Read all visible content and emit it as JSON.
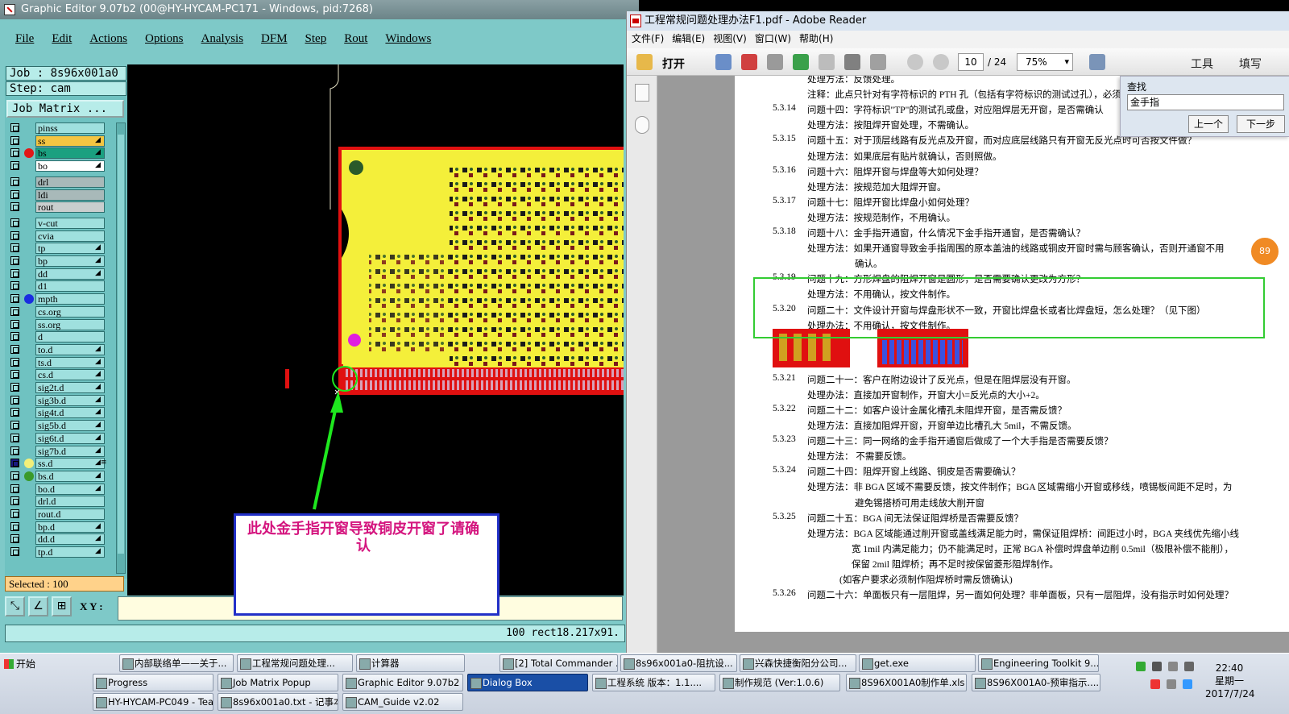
{
  "graphic_editor": {
    "title": "Graphic Editor 9.07b2 (00@HY-HYCAM-PC171 - Windows, pid:7268)",
    "menu": [
      "File",
      "Edit",
      "Actions",
      "Options",
      "Analysis",
      "DFM",
      "Step",
      "Rout",
      "Windows"
    ],
    "job": "Job : 8s96x001a0",
    "step": "Step: cam",
    "job_matrix": "Job Matrix ...",
    "layers": [
      {
        "name": "pinss",
        "mark": "",
        "dot": ""
      },
      {
        "name": "ss",
        "mark": "◢",
        "dot": "",
        "bg": "#f4c542"
      },
      {
        "name": "bs",
        "mark": "◢",
        "dot": "#e01818",
        "bg": "#1aa080"
      },
      {
        "name": "bo",
        "mark": "◢",
        "dot": "",
        "bg": "#ffffff"
      },
      {
        "name": "drl",
        "mark": "",
        "dot": "",
        "bg": "#a8b9b9"
      },
      {
        "name": "ldi",
        "mark": "",
        "dot": "",
        "bg": "#a8b9b9"
      },
      {
        "name": "rout",
        "mark": "",
        "dot": "",
        "bg": "#c9cece"
      },
      {
        "name": "v-cut",
        "mark": "",
        "dot": ""
      },
      {
        "name": "cvia",
        "mark": "",
        "dot": ""
      },
      {
        "name": "tp",
        "mark": "◢",
        "dot": ""
      },
      {
        "name": "bp",
        "mark": "◢",
        "dot": ""
      },
      {
        "name": "dd",
        "mark": "◢",
        "dot": ""
      },
      {
        "name": "d1",
        "mark": "",
        "dot": ""
      },
      {
        "name": "mpth",
        "mark": "",
        "dot": "#1a2de0"
      },
      {
        "name": "cs.org",
        "mark": "",
        "dot": ""
      },
      {
        "name": "ss.org",
        "mark": "",
        "dot": ""
      },
      {
        "name": "d",
        "mark": "",
        "dot": ""
      },
      {
        "name": "to.d",
        "mark": "◢",
        "dot": ""
      },
      {
        "name": "ts.d",
        "mark": "◢",
        "dot": ""
      },
      {
        "name": "cs.d",
        "mark": "◢",
        "dot": ""
      },
      {
        "name": "sig2t.d",
        "mark": "◢",
        "dot": ""
      },
      {
        "name": "sig3b.d",
        "mark": "◢",
        "dot": ""
      },
      {
        "name": "sig4t.d",
        "mark": "◢",
        "dot": ""
      },
      {
        "name": "sig5b.d",
        "mark": "◢",
        "dot": ""
      },
      {
        "name": "sig6t.d",
        "mark": "◢",
        "dot": ""
      },
      {
        "name": "sig7b.d",
        "mark": "◢",
        "dot": ""
      },
      {
        "name": "ss.d",
        "mark": "◢≡",
        "dot": "#f2f07a"
      },
      {
        "name": "bs.d",
        "mark": "◢",
        "dot": "#3a9a2a"
      },
      {
        "name": "bo.d",
        "mark": "◢",
        "dot": ""
      },
      {
        "name": "drl.d",
        "mark": "",
        "dot": ""
      },
      {
        "name": "rout.d",
        "mark": "",
        "dot": ""
      },
      {
        "name": "bp.d",
        "mark": "◢",
        "dot": ""
      },
      {
        "name": "dd.d",
        "mark": "◢",
        "dot": ""
      },
      {
        "name": "tp.d",
        "mark": "◢",
        "dot": ""
      }
    ],
    "selected": "Selected : 100",
    "xy_label": "X Y :",
    "status": "100 rect18.217x91."
  },
  "callout_text": "此处金手指开窗导致铜皮开窗了请确认",
  "reader": {
    "title": "工程常规问题处理办法F1.pdf - Adobe Reader",
    "menu": [
      "文件(F)",
      "编辑(E)",
      "视图(V)",
      "窗口(W)",
      "帮助(H)"
    ],
    "open_label": "打开",
    "page": "10",
    "page_total": "/ 24",
    "zoom": "75%",
    "tools": "工具",
    "fill": "填写",
    "find_title": "查找",
    "find_value": "金手指",
    "find_prev": "上一个",
    "find_next": "下一步",
    "orb": "89",
    "lines": [
      {
        "num": "",
        "text": "处理方法：反馈处理。",
        "indent": 1
      },
      {
        "num": "",
        "text": "注释：此点只针对有字符标识的 PTH 孔（包括有字符标识的测试过孔），必须",
        "indent": 1
      },
      {
        "num": "5.3.14",
        "text": "问题十四：字符标识\"TP\"的测试孔或盘，对应阻焊层无开窗，是否需确认",
        "indent": 0
      },
      {
        "num": "",
        "text": "处理方法：按阻焊开窗处理，不需确认。",
        "indent": 1
      },
      {
        "num": "5.3.15",
        "text": "问题十五：对于顶层线路有反光点及开窗，而对应底层线路只有开窗无反光点时可否按文件做？",
        "indent": 0
      },
      {
        "num": "",
        "text": "处理方法：如果底层有贴片就确认，否则照做。",
        "indent": 1
      },
      {
        "num": "5.3.16",
        "text": "问题十六：阻焊开窗与焊盘等大如何处理？",
        "indent": 0
      },
      {
        "num": "",
        "text": "处理方法：按规范加大阻焊开窗。",
        "indent": 1
      },
      {
        "num": "5.3.17",
        "text": "问题十七：阻焊开窗比焊盘小如何处理？",
        "indent": 0
      },
      {
        "num": "",
        "text": "处理方法：按规范制作，不用确认。",
        "indent": 1
      },
      {
        "num": "5.3.18",
        "text": "问题十八：金手指开通窗，什么情况下金手指开通窗，是否需确认？",
        "indent": 0
      },
      {
        "num": "",
        "text": "处理方法：如果开通窗导致金手指周围的原本盖油的线路或铜皮开窗时需与顾客确认，否则开通窗不用",
        "indent": 1
      },
      {
        "num": "",
        "text": "确认。",
        "indent": 2
      },
      {
        "num": "5.3.19",
        "text": "问题十九：方形焊盘的阻焊开窗是圆形，是否需要确认更改为方形？",
        "indent": 0
      },
      {
        "num": "",
        "text": "处理方法：不用确认，按文件制作。",
        "indent": 1
      },
      {
        "num": "5.3.20",
        "text": "问题二十：文件设计开窗与焊盘形状不一致，开窗比焊盘长或者比焊盘短，怎么处理？（见下图）",
        "indent": 0
      },
      {
        "num": "",
        "text": "处理办法：不用确认，按文件制作。",
        "indent": 1
      },
      {
        "num": "5.3.21",
        "text": "问题二十一：客户在附边设计了反光点，但是在阻焊层没有开窗。",
        "indent": 0
      },
      {
        "num": "",
        "text": "处理办法：直接加开窗制作，开窗大小=反光点的大小+2。",
        "indent": 1
      },
      {
        "num": "5.3.22",
        "text": "问题二十二：如客户设计金属化槽孔未阻焊开窗，是否需反馈？",
        "indent": 0
      },
      {
        "num": "",
        "text": "处理方法：直接加阻焊开窗，开窗单边比槽孔大 5mil，不需反馈。",
        "indent": 1
      },
      {
        "num": "5.3.23",
        "text": "问题二十三：同一网络的金手指开通窗后做成了一个大手指是否需要反馈？",
        "indent": 0
      },
      {
        "num": "",
        "text": "处理方法：  不需要反馈。",
        "indent": 1
      },
      {
        "num": "5.3.24",
        "text": "问题二十四：阻焊开窗上线路、铜皮是否需要确认？",
        "indent": 0
      },
      {
        "num": "",
        "text": "处理方法：非 BGA 区域不需要反馈，按文件制作；BGA 区域需缩小开窗或移线，喷锡板间距不足时，为",
        "indent": 1
      },
      {
        "num": "",
        "text": "避免锡搭桥可用走线放大削开窗",
        "indent": 2
      },
      {
        "num": "5.3.25",
        "text": "问题二十五：BGA 间无法保证阻焊桥是否需要反馈？",
        "indent": 0
      },
      {
        "num": "",
        "text": "处理方法：BGA 区域能通过削开窗或盖线满足能力时，需保证阻焊桥：间距过小时，BGA 夹线优先缩小线",
        "indent": 1
      },
      {
        "num": "",
        "text": "宽 1mil 内满足能力；仍不能满足时，正常 BGA 补偿时焊盘单边削 0.5mil（极限补偿不能削），",
        "indent": 3
      },
      {
        "num": "",
        "text": "保留 2mil 阻焊桥；再不足时按保留菱形阻焊制作。",
        "indent": 3
      },
      {
        "num": "",
        "text": "(如客户要求必须制作阻焊桥时需反馈确认)",
        "indent": 4
      },
      {
        "num": "5.3.26",
        "text": "问题二十六：单面板只有一层阻焊，另一面如何处理？非单面板，只有一层阻焊，没有指示时如何处理？",
        "indent": 0
      }
    ]
  },
  "taskbar": {
    "start": "开始",
    "row1": [
      {
        "label": "内部联络单——关于...",
        "active": false
      },
      {
        "label": "工程常规问题处理...",
        "active": false
      },
      {
        "label": "计算器",
        "active": false
      },
      {
        "label": "[2] Total Commander ...",
        "active": false
      },
      {
        "label": "8s96x001a0-阻抗设...",
        "active": false
      },
      {
        "label": "兴森快捷衡阳分公司...",
        "active": false
      },
      {
        "label": "get.exe",
        "active": false
      },
      {
        "label": "Engineering Toolkit 9....",
        "active": false
      }
    ],
    "row2": [
      {
        "label": "Progress",
        "active": false
      },
      {
        "label": "Job Matrix Popup",
        "active": false
      },
      {
        "label": "Graphic Editor 9.07b2 (0...",
        "active": false
      },
      {
        "label": "Dialog Box",
        "active": true
      },
      {
        "label": "工程系统  版本：1.1....",
        "active": false
      },
      {
        "label": "制作规范 (Ver:1.0.6)",
        "active": false
      },
      {
        "label": "8S96X001A0制作单.xls ...",
        "active": false
      },
      {
        "label": "8S96X001A0-预审指示....",
        "active": false
      }
    ],
    "row3": [
      {
        "label": "HY-HYCAM-PC049 - Tea...",
        "active": false
      },
      {
        "label": "8s96x001a0.txt - 记事本",
        "active": false
      },
      {
        "label": "CAM_Guide v2.02",
        "active": false
      }
    ],
    "time": "22:40",
    "weekday": "星期一",
    "date": "2017/7/24"
  },
  "colors": {
    "board_yellow": "#f4ef3a",
    "board_red": "#e01010",
    "arrow_green": "#1ee81e",
    "callout_border": "#2230c8",
    "callout_text": "#d4147e",
    "highlight_green": "#33cc33"
  }
}
